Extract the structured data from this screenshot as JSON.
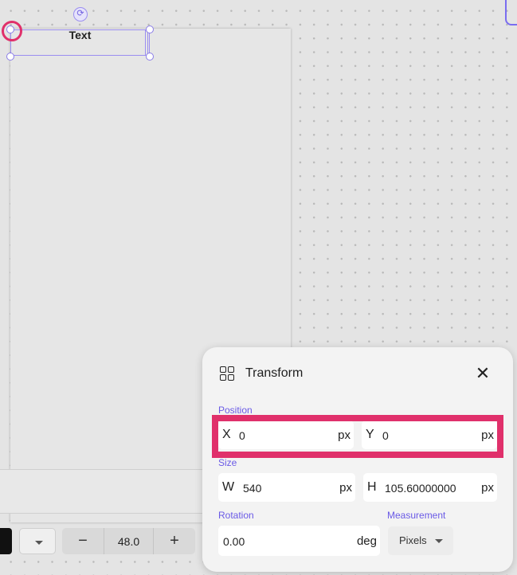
{
  "canvas": {
    "text_object": "Text"
  },
  "toolbar": {
    "font_size": "48.0",
    "minus_label": "−",
    "plus_label": "+"
  },
  "transform_panel": {
    "title": "Transform",
    "close_label": "✕",
    "position": {
      "label": "Position",
      "x_label": "X",
      "x_value": "0",
      "x_unit": "px",
      "y_label": "Y",
      "y_value": "0",
      "y_unit": "px"
    },
    "size": {
      "label": "Size",
      "w_label": "W",
      "w_value": "540",
      "w_unit": "px",
      "h_label": "H",
      "h_value": "105.60000000",
      "h_unit": "px"
    },
    "rotation": {
      "label": "Rotation",
      "value": "0.00",
      "unit": "deg"
    },
    "measurement": {
      "label": "Measurement",
      "selected": "Pixels"
    }
  },
  "colors": {
    "accent": "#6a5ae6",
    "highlight": "#e0306b",
    "selection": "#9b8ef0"
  },
  "icons": {
    "panel_icon": "grid-four-squares-icon",
    "rotate": "rotate-icon",
    "close": "close-icon",
    "dropdown": "chevron-down-icon"
  }
}
